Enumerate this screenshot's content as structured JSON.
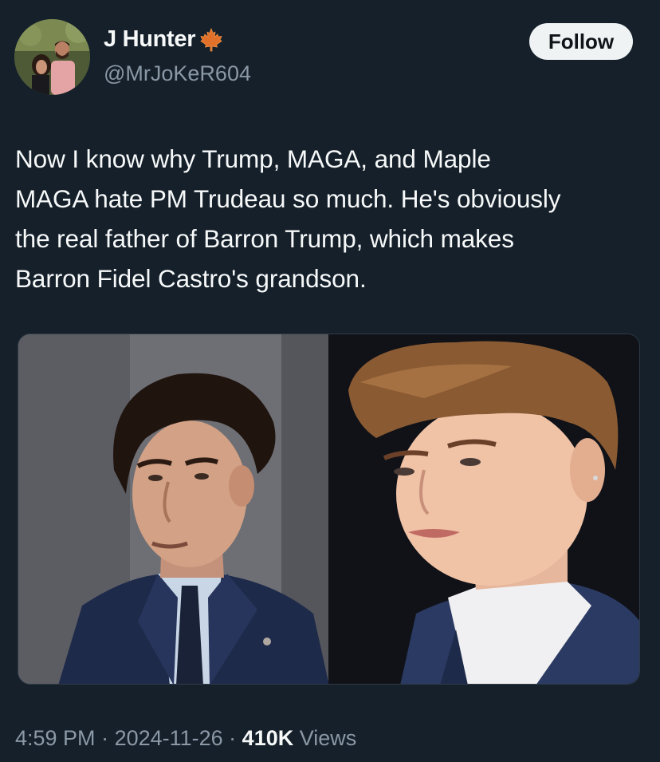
{
  "author": {
    "display_name": "J Hunter",
    "handle": "@MrJoKeR604",
    "badge_icon": "maple-leaf-icon",
    "follow_label": "Follow"
  },
  "tweet": {
    "text": "Now I know why Trump, MAGA, and Maple\nMAGA hate PM Trudeau so much. He's obviously\nthe real father of Barron Trump, which makes\nBarron Fidel Castro's grandson."
  },
  "media": {
    "photos": [
      "photo-man-in-suit-left",
      "photo-young-man-in-suit-right"
    ]
  },
  "meta": {
    "time": "4:59 PM",
    "separator": " · ",
    "date": "2024-11-26",
    "views_count": "410K",
    "views_label": " Views"
  },
  "colors": {
    "background": "#15202b",
    "text_primary": "#f7f9f9",
    "text_secondary": "#8b98a5",
    "follow_button_bg": "#eff3f4",
    "maple_leaf": "#e0702a"
  }
}
